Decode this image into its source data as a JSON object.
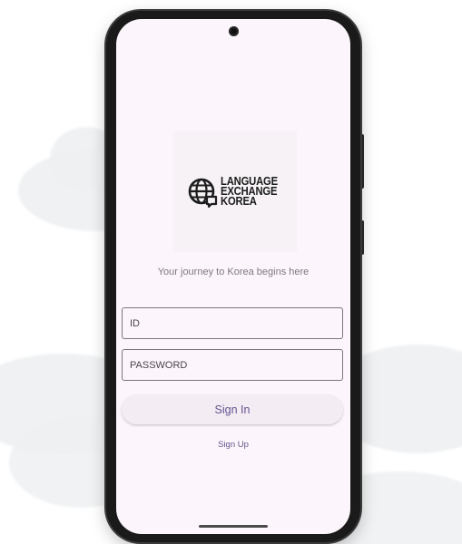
{
  "logo": {
    "lines": [
      "LANGUAGE",
      "EXCHANGE",
      "KOREA"
    ],
    "icon": "globe-chat-icon"
  },
  "tagline": "Your journey to Korea begins here",
  "form": {
    "id_placeholder": "ID",
    "id_value": "",
    "password_placeholder": "PASSWORD",
    "password_value": ""
  },
  "buttons": {
    "signin_label": "Sign In",
    "signup_label": "Sign Up"
  },
  "colors": {
    "screen_bg": "#fcf5fb",
    "accent": "#65558f",
    "button_bg": "#f3ecf3"
  }
}
